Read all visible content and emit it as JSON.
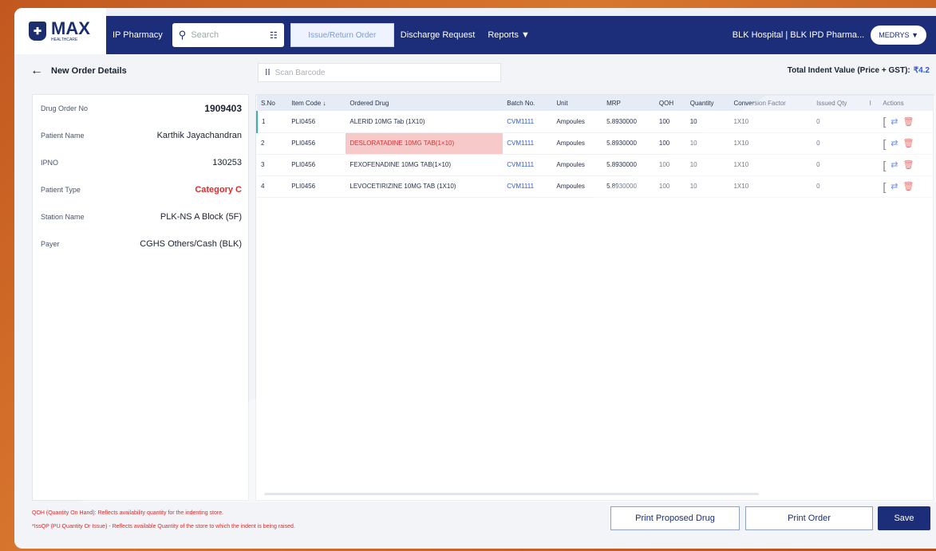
{
  "brand": {
    "name": "MAX",
    "tagline": "HEALTHCARE"
  },
  "nav": {
    "ip_pharmacy": "IP Pharmacy",
    "search_placeholder": "Search",
    "issue_return": "Issue/Return Order",
    "discharge": "Discharge Request",
    "reports": "Reports",
    "location": "BLK Hospital | BLK IPD Pharma...",
    "user": "MEDRYS"
  },
  "subbar": {
    "title": "New Order Details",
    "scan_placeholder": "Scan Barcode",
    "total_label": "Total Indent Value (Price + GST):",
    "total_value": "₹4.2"
  },
  "details": [
    {
      "label": "Drug Order No",
      "value": "1909403"
    },
    {
      "label": "Patient Name",
      "value": "Karthik Jayachandran"
    },
    {
      "label": "IPNO",
      "value": "130253"
    },
    {
      "label": "Patient Type",
      "value": "Category C"
    },
    {
      "label": "Station Name",
      "value": "PLK-NS A Block (5F)"
    },
    {
      "label": "Payer",
      "value": "CGHS Others/Cash (BLK)"
    }
  ],
  "table": {
    "headers": [
      "S.No",
      "Item Code ↓",
      "Ordered Drug",
      "Batch No.",
      "Unit",
      "MRP",
      "QOH",
      "Quantity",
      "Conversion Factor",
      "Issued Qty",
      "I",
      "Actions"
    ],
    "rows": [
      [
        "1",
        "PLI0456",
        "ALERID 10MG Tab (1X10)",
        "CVM1111",
        "Ampoules",
        "5.8930000",
        "100",
        "10",
        "1X10",
        "0"
      ],
      [
        "2",
        "PLI0456",
        "DESLORATADINE 10MG TAB(1×10)",
        "CVM1111",
        "Ampoules",
        "5.8930000",
        "100",
        "10",
        "1X10",
        "0"
      ],
      [
        "3",
        "PLI0456",
        "FEXOFENADINE 10MG TAB(1×10)",
        "CVM1111",
        "Ampoules",
        "5.8930000",
        "100",
        "10",
        "1X10",
        "0"
      ],
      [
        "4",
        "PLI0456",
        "LEVOCETIRIZINE 10MG TAB (1X10)",
        "CVM1111",
        "Ampoules",
        "5.8930000",
        "100",
        "10",
        "1X10",
        "0"
      ]
    ]
  },
  "footer": {
    "note1": "QOH (Quantity On Hand): Reflects availability quantity for the indenting store.",
    "note2": "*IssQP (PU Quantity Or Issue) - Reflects available Quantity of the store to which the indent is being raised."
  },
  "buttons": {
    "print_proposed": "Print Proposed Drug",
    "print_order": "Print Order",
    "save": "Save"
  },
  "colors": {
    "primary": "#1c2e7a",
    "danger": "#e02a2a",
    "link": "#2d5bd8"
  }
}
